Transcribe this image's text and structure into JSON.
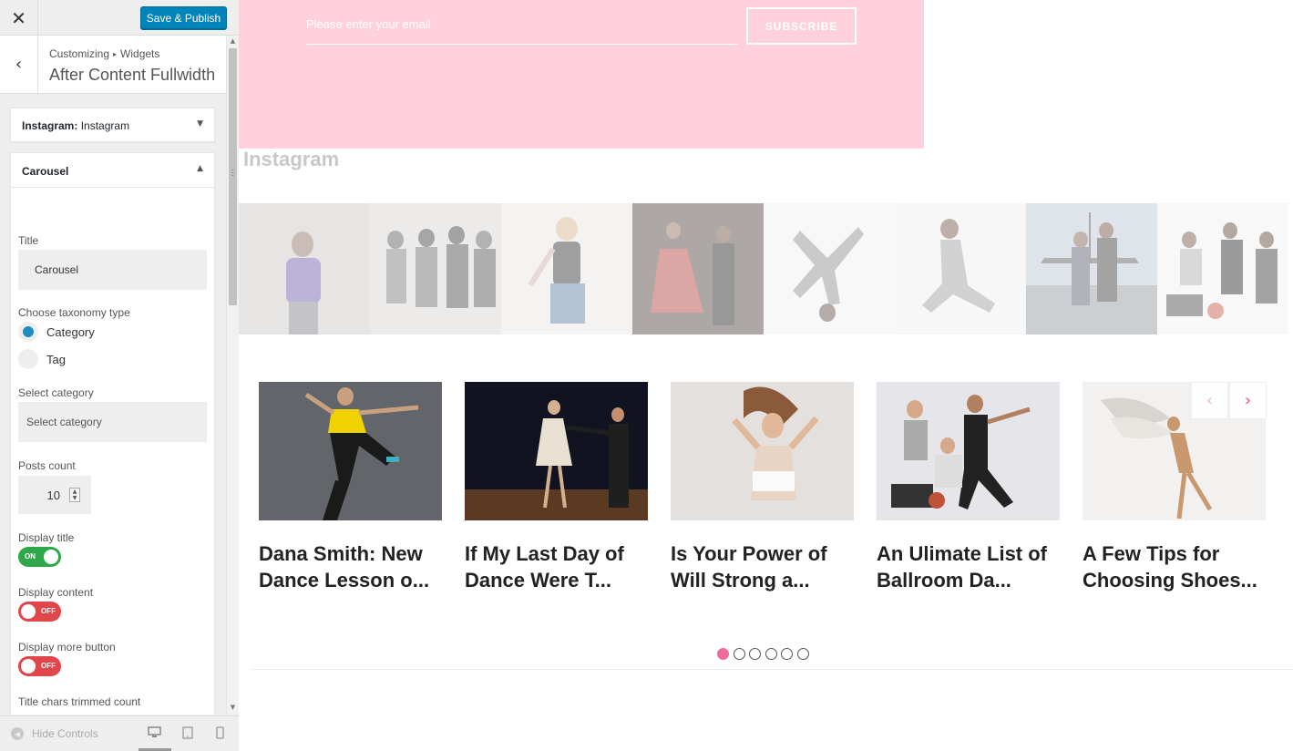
{
  "topbar": {
    "close_icon": "close-icon",
    "publish_label": "Save & Publish"
  },
  "section": {
    "breadcrumb_root": "Customizing",
    "breadcrumb_sep": "▸",
    "breadcrumb_leaf": "Widgets",
    "title": "After Content Fullwidth"
  },
  "widgets": {
    "instagram": {
      "type": "Instagram:",
      "name": "Instagram"
    },
    "carousel": {
      "header": "Carousel",
      "title_label": "Title",
      "title_value": "Carousel",
      "taxonomy_label": "Choose taxonomy type",
      "taxonomy_options": [
        {
          "label": "Category",
          "checked": true
        },
        {
          "label": "Tag",
          "checked": false
        }
      ],
      "category_label": "Select category",
      "category_value": "Select category",
      "posts_count_label": "Posts count",
      "posts_count_value": "10",
      "display_title_label": "Display title",
      "display_title_state": "ON",
      "display_content_label": "Display content",
      "display_content_state": "OFF",
      "display_more_label": "Display more button",
      "display_more_state": "OFF",
      "title_chars_label": "Title chars trimmed count",
      "title_chars_fraction": 0.33
    }
  },
  "footer": {
    "hide_controls_label": "Hide Controls",
    "devices": [
      "desktop-icon",
      "tablet-icon",
      "mobile-icon"
    ]
  },
  "preview": {
    "newsletter": {
      "placeholder": "Please enter your email",
      "button": "SUBSCRIBE",
      "bg": "#ffd1dc"
    },
    "instagram_heading": "Instagram",
    "posts": [
      {
        "title_line1": "Dana Smith: New",
        "title_line2": "Dance Lesson o..."
      },
      {
        "title_line1": "If My Last Day of",
        "title_line2": "Dance Were T..."
      },
      {
        "title_line1": "Is Your Power of",
        "title_line2": "Will Strong a..."
      },
      {
        "title_line1": "An Ulimate List of",
        "title_line2": "Ballroom Da..."
      },
      {
        "title_line1": "A Few Tips for",
        "title_line2": "Choosing Shoes..."
      }
    ],
    "pagination": {
      "pages": 6,
      "active": 1
    },
    "accent": "#f06c9b"
  }
}
